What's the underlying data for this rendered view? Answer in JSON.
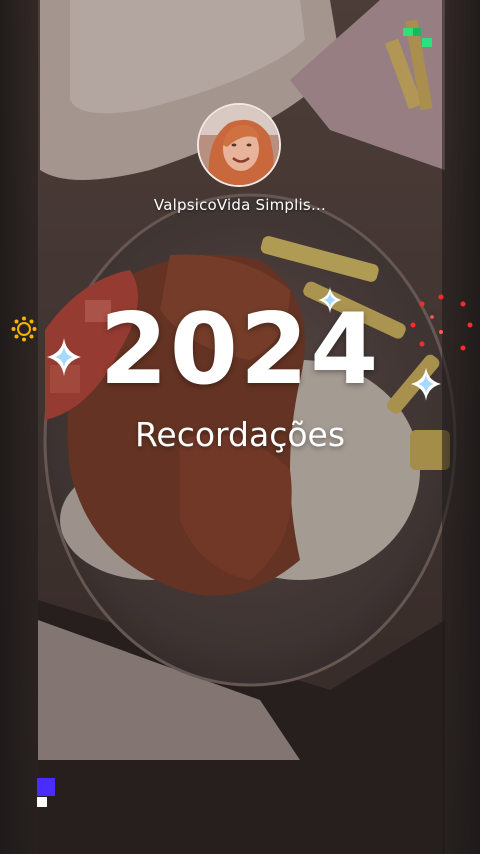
{
  "story": {
    "username": "ValpsicoVida Simplis…",
    "title_year": "2024",
    "title_subtitle": "Recordações"
  },
  "colors": {
    "sparkle_blue": "#a9d8ff",
    "deco_green": "#2ee07a",
    "deco_red": "#ff2a2a",
    "deco_gold": "#f5b400",
    "deco_purple": "#4a2cff"
  },
  "icons": {
    "sparkle": "four-point-star-icon",
    "firework": "firework-dots-icon",
    "sun": "sun-ring-icon",
    "pixel": "pixel-block-icon"
  }
}
